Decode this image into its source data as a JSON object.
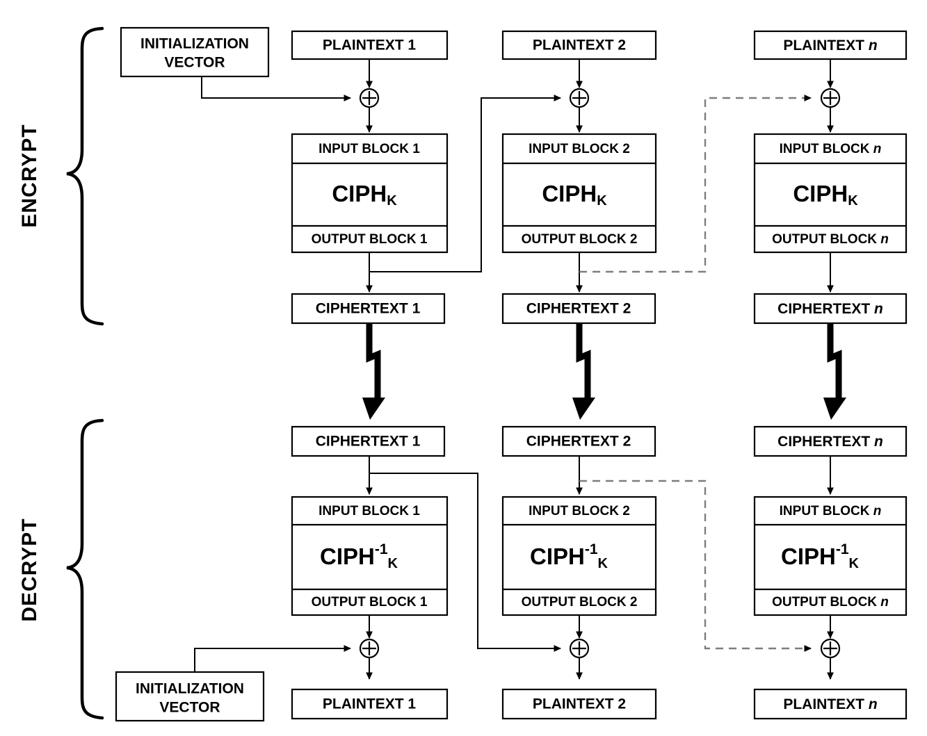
{
  "diagram": {
    "title": "CBC mode encryption and decryption block diagram",
    "sections": [
      {
        "id": "encrypt",
        "label": "ENCRYPT"
      },
      {
        "id": "decrypt",
        "label": "DECRYPT"
      }
    ],
    "colors": {
      "line": "#000000",
      "dashed_line": "#7d7d7d",
      "box_fill": "#ffffff",
      "text": "#000000"
    },
    "encrypt": {
      "iv": {
        "line1": "INITIALIZATION",
        "line2": "VECTOR"
      },
      "columns": [
        {
          "index": "1",
          "plaintext": "PLAINTEXT 1",
          "input_block": "INPUT BLOCK 1",
          "cipher": "CIPH",
          "cipher_sub": "K",
          "cipher_sup": "",
          "output_block": "OUTPUT BLOCK 1",
          "ciphertext": "CIPHERTEXT 1"
        },
        {
          "index": "2",
          "plaintext": "PLAINTEXT 2",
          "input_block": "INPUT BLOCK 2",
          "cipher": "CIPH",
          "cipher_sub": "K",
          "cipher_sup": "",
          "output_block": "OUTPUT BLOCK 2",
          "ciphertext": "CIPHERTEXT 2"
        },
        {
          "index": "n",
          "plaintext_pre": "PLAINTEXT ",
          "plaintext_n": "n",
          "input_block_pre": "INPUT BLOCK ",
          "input_block_n": "n",
          "cipher": "CIPH",
          "cipher_sub": "K",
          "cipher_sup": "",
          "output_block_pre": "OUTPUT BLOCK ",
          "output_block_n": "n",
          "ciphertext_pre": "CIPHERTEXT ",
          "ciphertext_n": "n"
        }
      ]
    },
    "decrypt": {
      "iv": {
        "line1": "INITIALIZATION",
        "line2": "VECTOR"
      },
      "columns": [
        {
          "index": "1",
          "ciphertext": "CIPHERTEXT 1",
          "input_block": "INPUT BLOCK 1",
          "cipher": "CIPH",
          "cipher_sup": "-1",
          "cipher_sub": "K",
          "output_block": "OUTPUT BLOCK 1",
          "plaintext": "PLAINTEXT 1"
        },
        {
          "index": "2",
          "ciphertext": "CIPHERTEXT 2",
          "input_block": "INPUT BLOCK 2",
          "cipher": "CIPH",
          "cipher_sup": "-1",
          "cipher_sub": "K",
          "output_block": "OUTPUT BLOCK 2",
          "plaintext": "PLAINTEXT 2"
        },
        {
          "index": "n",
          "ciphertext_pre": "CIPHERTEXT ",
          "ciphertext_n": "n",
          "input_block_pre": "INPUT BLOCK ",
          "input_block_n": "n",
          "cipher": "CIPH",
          "cipher_sup": "-1",
          "cipher_sub": "K",
          "output_block_pre": "OUTPUT BLOCK ",
          "output_block_n": "n",
          "plaintext_pre": "PLAINTEXT ",
          "plaintext_n": "n"
        }
      ]
    },
    "icons": {
      "xor": "xor-operator-icon",
      "arrow": "arrowhead-icon",
      "bolt": "lightning-bolt-icon",
      "brace": "curly-brace-icon"
    }
  }
}
